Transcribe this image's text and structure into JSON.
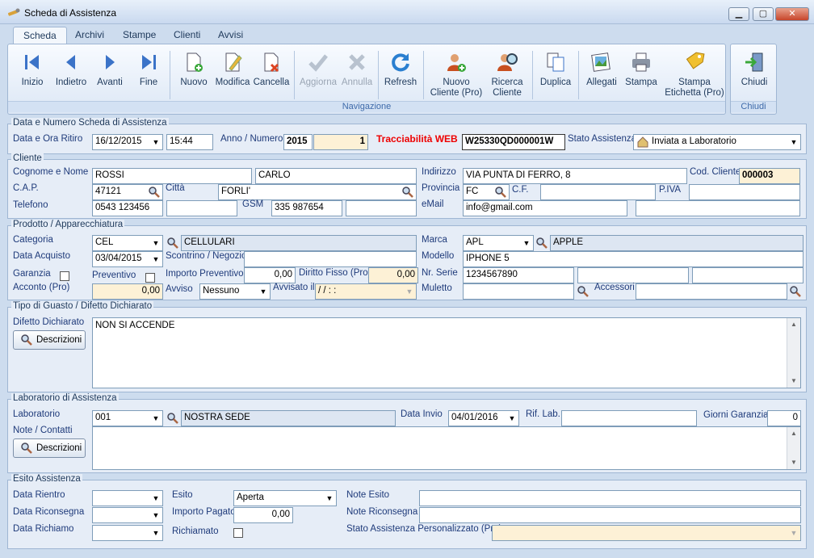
{
  "window": {
    "title": "Scheda di Assistenza"
  },
  "tabs": [
    "Scheda",
    "Archivi",
    "Stampe",
    "Clienti",
    "Avvisi"
  ],
  "ribbon": {
    "buttons": {
      "inizio": "Inizio",
      "indietro": "Indietro",
      "avanti": "Avanti",
      "fine": "Fine",
      "nuovo": "Nuovo",
      "modifica": "Modifica",
      "cancella": "Cancella",
      "aggiorna": "Aggiorna",
      "annulla": "Annulla",
      "refresh": "Refresh",
      "nuovo_cliente_1": "Nuovo",
      "nuovo_cliente_2": "Cliente (Pro)",
      "ricerca_cliente_1": "Ricerca",
      "ricerca_cliente_2": "Cliente",
      "duplica": "Duplica",
      "allegati": "Allegati",
      "stampa": "Stampa",
      "stampa_etichetta_1": "Stampa",
      "stampa_etichetta_2": "Etichetta (Pro)",
      "chiudi": "Chiudi"
    },
    "group_nav": "Navigazione",
    "group_close": "Chiudi"
  },
  "sec_data": {
    "title": "Data e Numero Scheda di Assistenza",
    "data_ora_label": "Data e Ora Ritiro",
    "data": "16/12/2015",
    "ora": "15:44",
    "anno_numero_label": "Anno / Numero",
    "anno": "2015",
    "numero": "1",
    "tracciabilita_label": "Tracciabilità WEB",
    "tracciabilita_code": "W25330QD000001W",
    "stato_label": "Stato Assistenza",
    "stato_value": "Inviata a Laboratorio"
  },
  "sec_cliente": {
    "title": "Cliente",
    "cognome_nome_label": "Cognome e Nome",
    "cognome": "ROSSI",
    "nome": "CARLO",
    "indirizzo_label": "Indirizzo",
    "indirizzo": "VIA PUNTA DI FERRO, 8",
    "cod_cliente_label": "Cod. Cliente",
    "cod_cliente": "000003",
    "cap_label": "C.A.P.",
    "cap": "47121",
    "citta_label": "Città",
    "citta": "FORLI'",
    "provincia_label": "Provincia",
    "provincia": "FC",
    "cf_label": "C.F.",
    "piva_label": "P.IVA",
    "telefono_label": "Telefono",
    "telefono": "0543 123456",
    "gsm_label": "GSM",
    "gsm": "335 987654",
    "email_label": "eMail",
    "email": "info@gmail.com"
  },
  "sec_prodotto": {
    "title": "Prodotto / Apparecchiatura",
    "categoria_label": "Categoria",
    "categoria_code": "CEL",
    "categoria_desc": "CELLULARI",
    "marca_label": "Marca",
    "marca_code": "APL",
    "marca_desc": "APPLE",
    "data_acquisto_label": "Data Acquisto",
    "data_acquisto": "03/04/2015",
    "scontrino_label": "Scontrino / Negozio",
    "modello_label": "Modello",
    "modello": "IPHONE 5",
    "garanzia_label": "Garanzia",
    "preventivo_label": "Preventivo",
    "importo_prev_label": "Importo Preventivo",
    "importo_prev": "0,00",
    "diritto_fisso_label": "Diritto Fisso (Pro)",
    "diritto_fisso": "0,00",
    "nr_serie_label": "Nr. Serie",
    "nr_serie": "1234567890",
    "acconto_label": "Acconto (Pro)",
    "acconto": "0,00",
    "avviso_label": "Avviso",
    "avviso_value": "Nessuno",
    "avvisato_label": "Avvisato il",
    "avvisato_value": "/ /      : :",
    "muletto_label": "Muletto",
    "accessori_label": "Accessori"
  },
  "sec_guasto": {
    "title": "Tipo di Guasto / Difetto Dichiarato",
    "difetto_label": "Difetto Dichiarato",
    "descrizioni_btn": "Descrizioni",
    "difetto_text": "NON SI ACCENDE"
  },
  "sec_lab": {
    "title": "Laboratorio di Assistenza",
    "lab_label": "Laboratorio",
    "lab_code": "001",
    "lab_desc": "NOSTRA SEDE",
    "data_invio_label": "Data Invio",
    "data_invio": "04/01/2016",
    "rif_lab_label": "Rif. Lab.",
    "giorni_label": "Giorni Garanzia",
    "giorni": "0",
    "note_label": "Note / Contatti",
    "descrizioni_btn": "Descrizioni"
  },
  "sec_esito": {
    "title": "Esito Assistenza",
    "data_rientro_label": "Data Rientro",
    "esito_label": "Esito",
    "esito_value": "Aperta",
    "note_esito_label": "Note Esito",
    "data_riconsegna_label": "Data Riconsegna",
    "importo_pagato_label": "Importo Pagato",
    "importo_pagato": "0,00",
    "note_riconsegna_label": "Note Riconsegna",
    "data_richiamo_label": "Data Richiamo",
    "richiamato_label": "Richiamato",
    "stato_pers_label": "Stato Assistenza Personalizzato (Pro)"
  }
}
